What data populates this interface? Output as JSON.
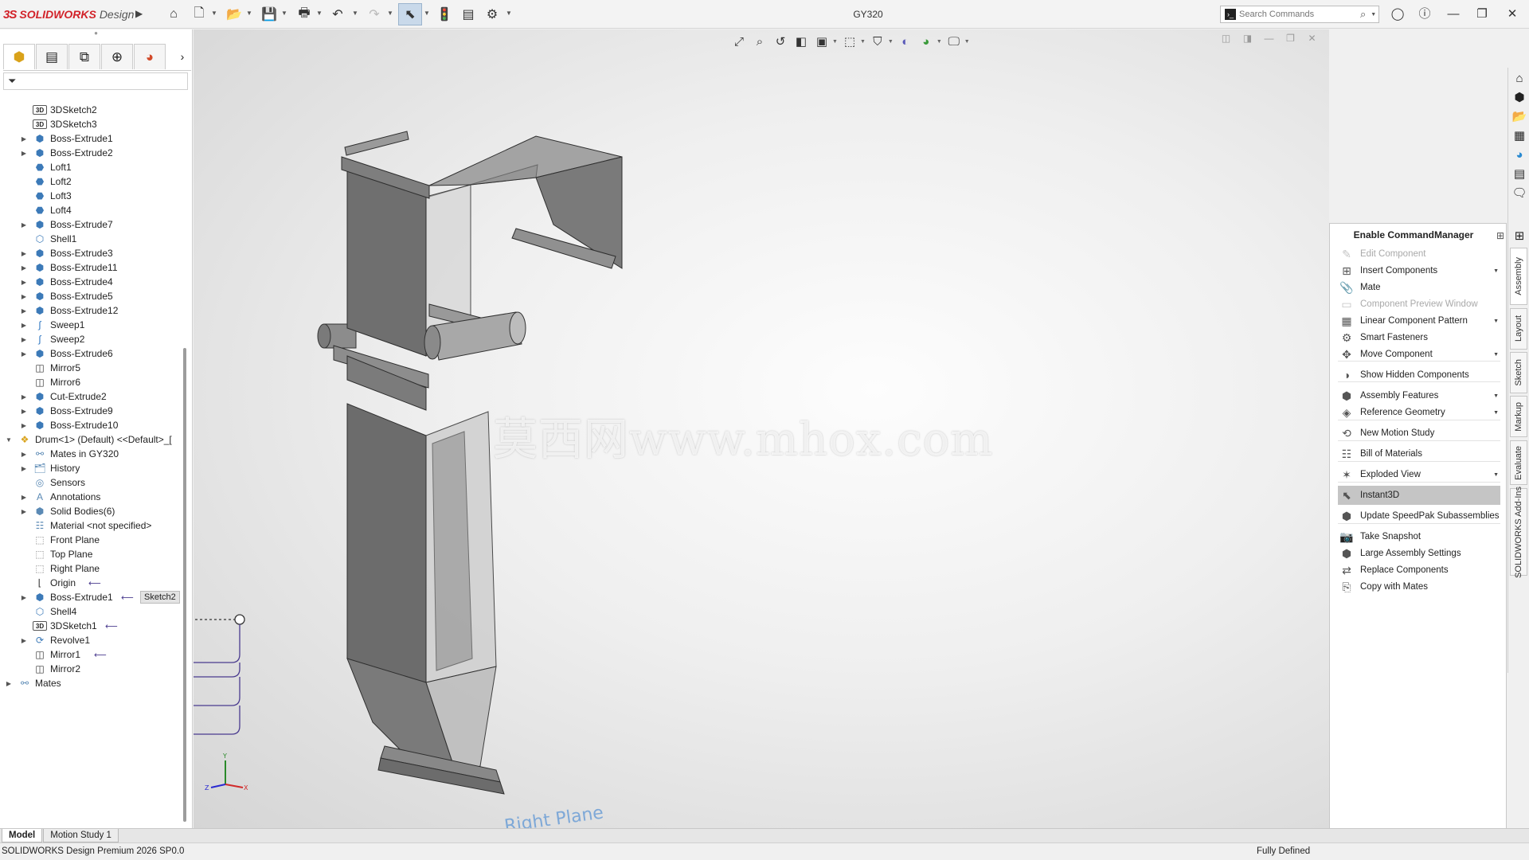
{
  "app": {
    "logo_ds": "3S",
    "logo_brand": "SOLIDWORKS",
    "logo_product": "Design",
    "document_title": "GY320"
  },
  "search": {
    "placeholder": "Search Commands"
  },
  "toolbar_icons": [
    "home-icon",
    "new-document-icon",
    "open-icon",
    "save-icon",
    "print-icon",
    "undo-icon",
    "redo-icon",
    "select-icon",
    "rebuild-icon",
    "file-properties-icon",
    "options-icon"
  ],
  "panel_tabs": [
    "featuremanager-tree-icon",
    "propertymanager-icon",
    "configurationmanager-icon",
    "dimxpertmanager-icon",
    "displaymanager-icon"
  ],
  "tree": [
    {
      "label": "3DSketch2",
      "icon": "3d",
      "expander": false
    },
    {
      "label": "3DSketch3",
      "icon": "3d",
      "expander": false
    },
    {
      "label": "Boss-Extrude1",
      "icon": "feat",
      "expander": true
    },
    {
      "label": "Boss-Extrude2",
      "icon": "feat",
      "expander": true
    },
    {
      "label": "Loft1",
      "icon": "loft",
      "expander": false
    },
    {
      "label": "Loft2",
      "icon": "loft",
      "expander": false
    },
    {
      "label": "Loft3",
      "icon": "loft",
      "expander": false
    },
    {
      "label": "Loft4",
      "icon": "loft",
      "expander": false
    },
    {
      "label": "Boss-Extrude7",
      "icon": "feat",
      "expander": true
    },
    {
      "label": "Shell1",
      "icon": "shell",
      "expander": false
    },
    {
      "label": "Boss-Extrude3",
      "icon": "feat",
      "expander": true
    },
    {
      "label": "Boss-Extrude11",
      "icon": "feat",
      "expander": true
    },
    {
      "label": "Boss-Extrude4",
      "icon": "feat",
      "expander": true
    },
    {
      "label": "Boss-Extrude5",
      "icon": "feat",
      "expander": true
    },
    {
      "label": "Boss-Extrude12",
      "icon": "feat",
      "expander": true
    },
    {
      "label": "Sweep1",
      "icon": "sweep",
      "expander": true
    },
    {
      "label": "Sweep2",
      "icon": "sweep",
      "expander": true
    },
    {
      "label": "Boss-Extrude6",
      "icon": "feat",
      "expander": true
    },
    {
      "label": "Mirror5",
      "icon": "mirror",
      "expander": false
    },
    {
      "label": "Mirror6",
      "icon": "mirror",
      "expander": false
    },
    {
      "label": "Cut-Extrude2",
      "icon": "cut",
      "expander": true
    },
    {
      "label": "Boss-Extrude9",
      "icon": "feat",
      "expander": true
    },
    {
      "label": "Boss-Extrude10",
      "icon": "feat",
      "expander": true
    },
    {
      "label": "Drum<1> (Default) <<Default>_[",
      "icon": "asm",
      "expander": "open",
      "level": 0
    },
    {
      "label": "Mates in GY320",
      "icon": "mates",
      "expander": true
    },
    {
      "label": "History",
      "icon": "history",
      "expander": true
    },
    {
      "label": "Sensors",
      "icon": "sensor",
      "expander": false
    },
    {
      "label": "Annotations",
      "icon": "annot",
      "expander": true
    },
    {
      "label": "Solid Bodies(6)",
      "icon": "bodies",
      "expander": true
    },
    {
      "label": "Material <not specified>",
      "icon": "material",
      "expander": false
    },
    {
      "label": "Front Plane",
      "icon": "plane",
      "expander": false
    },
    {
      "label": "Top Plane",
      "icon": "plane",
      "expander": false
    },
    {
      "label": "Right Plane",
      "icon": "plane",
      "expander": false
    },
    {
      "label": "Origin",
      "icon": "origin",
      "expander": false
    },
    {
      "label": "Boss-Extrude1",
      "icon": "feat",
      "expander": true,
      "tag": "Sketch2"
    },
    {
      "label": "Shell4",
      "icon": "shell",
      "expander": false
    },
    {
      "label": "3DSketch1",
      "icon": "3d",
      "expander": false
    },
    {
      "label": "Revolve1",
      "icon": "revolve",
      "expander": true
    },
    {
      "label": "Mirror1",
      "icon": "mirror",
      "expander": false
    },
    {
      "label": "Mirror2",
      "icon": "mirror",
      "expander": false
    },
    {
      "label": "Mates",
      "icon": "mates",
      "expander": true,
      "level": 0
    }
  ],
  "viewport": {
    "watermark": "莫西网www.mhox.com",
    "plane_label": "Right Plane",
    "triad": {
      "x": "X",
      "y": "Y",
      "z": "Z"
    }
  },
  "command_manager": {
    "header": "Enable CommandManager",
    "items": [
      {
        "label": "Edit Component",
        "icon": "edit-component-icon",
        "disabled": true,
        "dropdown": false
      },
      {
        "label": "Insert Components",
        "icon": "insert-components-icon",
        "disabled": false,
        "dropdown": true
      },
      {
        "label": "Mate",
        "icon": "mate-icon",
        "disabled": false,
        "dropdown": false
      },
      {
        "label": "Component Preview Window",
        "icon": "preview-window-icon",
        "disabled": true,
        "dropdown": false
      },
      {
        "label": "Linear Component Pattern",
        "icon": "linear-pattern-icon",
        "disabled": false,
        "dropdown": true
      },
      {
        "label": "Smart Fasteners",
        "icon": "smart-fasteners-icon",
        "disabled": false,
        "dropdown": false
      },
      {
        "label": "Move Component",
        "icon": "move-component-icon",
        "disabled": false,
        "dropdown": true
      },
      {
        "label": "Show Hidden Components",
        "icon": "show-hidden-icon",
        "disabled": false,
        "dropdown": false
      },
      {
        "label": "Assembly Features",
        "icon": "assembly-features-icon",
        "disabled": false,
        "dropdown": true
      },
      {
        "label": "Reference Geometry",
        "icon": "reference-geometry-icon",
        "disabled": false,
        "dropdown": true
      },
      {
        "label": "New Motion Study",
        "icon": "motion-study-icon",
        "disabled": false,
        "dropdown": false
      },
      {
        "label": "Bill of Materials",
        "icon": "bom-icon",
        "disabled": false,
        "dropdown": false
      },
      {
        "label": "Exploded View",
        "icon": "exploded-view-icon",
        "disabled": false,
        "dropdown": true
      },
      {
        "label": "Instant3D",
        "icon": "instant3d-icon",
        "disabled": false,
        "dropdown": false,
        "active": true
      },
      {
        "label": "Update SpeedPak Subassemblies",
        "icon": "speedpak-icon",
        "disabled": false,
        "dropdown": false
      },
      {
        "label": "Take Snapshot",
        "icon": "snapshot-icon",
        "disabled": false,
        "dropdown": false
      },
      {
        "label": "Large Assembly Settings",
        "icon": "large-assembly-icon",
        "disabled": false,
        "dropdown": false
      },
      {
        "label": "Replace Components",
        "icon": "replace-components-icon",
        "disabled": false,
        "dropdown": false
      },
      {
        "label": "Copy with Mates",
        "icon": "copy-with-mates-icon",
        "disabled": false,
        "dropdown": false
      }
    ]
  },
  "right_tabs": [
    "Assembly",
    "Layout",
    "Sketch",
    "Markup",
    "Evaluate",
    "SOLIDWORKS Add-Ins"
  ],
  "bottom_tabs": [
    "Model",
    "Motion Study 1"
  ],
  "status": {
    "left": "SOLIDWORKS Design Premium 2026 SP0.0",
    "right": "Fully Defined"
  },
  "colors": {
    "brand_red": "#d2232a",
    "selection_blue": "#3c78b4",
    "mate_line": "#4a3b8f",
    "model_dark": "#6e6e6e",
    "model_mid": "#8a8a8a"
  }
}
